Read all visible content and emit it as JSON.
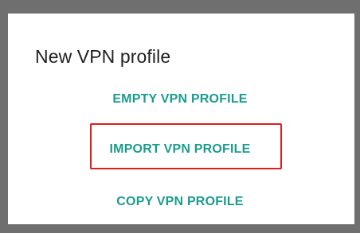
{
  "dialog": {
    "title": "New VPN profile",
    "options": [
      {
        "label": "EMPTY VPN PROFILE"
      },
      {
        "label": "IMPORT VPN PROFILE"
      },
      {
        "label": "COPY VPN PROFILE"
      }
    ]
  },
  "colors": {
    "accent": "#1a9c8c",
    "highlight": "#e21b1b",
    "scrim": "#6f6f6f",
    "title_text": "#212121"
  }
}
